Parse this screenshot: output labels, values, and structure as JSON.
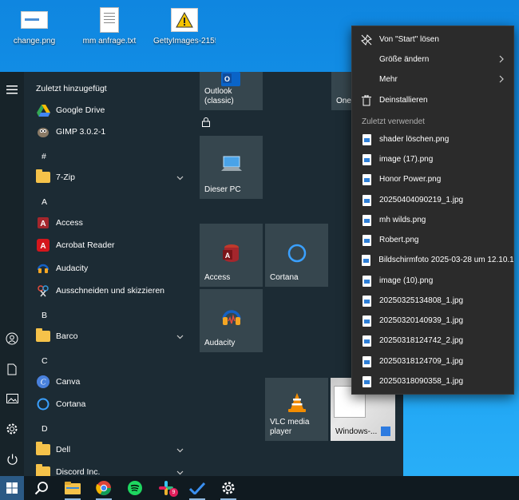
{
  "desktop": {
    "icons": [
      {
        "label": "change.png",
        "icon": "png-file-icon"
      },
      {
        "label": "mm anfrage.txt",
        "icon": "text-file-icon"
      },
      {
        "label": "GettyImages-21555...",
        "icon": "warning-icon"
      }
    ]
  },
  "start_menu": {
    "recently_added_label": "Zuletzt hinzugefügt",
    "apps": {
      "google_drive": "Google Drive",
      "gimp": "GIMP 3.0.2-1",
      "letter_hash": "#",
      "seven_zip": "7-Zip",
      "letter_a": "A",
      "access": "Access",
      "acrobat": "Acrobat Reader",
      "audacity": "Audacity",
      "snipping": "Ausschneiden und skizzieren",
      "letter_b": "B",
      "barco": "Barco",
      "letter_c": "C",
      "canva": "Canva",
      "cortana": "Cortana",
      "letter_d": "D",
      "dell": "Dell",
      "discord": "Discord Inc."
    },
    "tiles": {
      "outlook": "Outlook (classic)",
      "onenote_partial": "Onel",
      "this_pc": "Dieser PC",
      "access": "Access",
      "cortana": "Cortana",
      "audacity": "Audacity",
      "vlc": "VLC media player",
      "windows": "Windows-..."
    }
  },
  "context_menu": {
    "unpin": "Von \"Start\" lösen",
    "resize": "Größe ändern",
    "more": "Mehr",
    "uninstall": "Deinstallieren",
    "recent_header": "Zuletzt verwendet",
    "recent_files": [
      "shader löschen.png",
      "image (17).png",
      "Honor Power.png",
      "20250404090219_1.jpg",
      "mh wilds.png",
      "Robert.png",
      "Bildschirmfoto 2025-03-28 um 12.10.1...",
      "image (10).png",
      "20250325134808_1.jpg",
      "20250320140939_1.jpg",
      "20250318124742_2.jpg",
      "20250318124709_1.jpg",
      "20250318090358_1.jpg"
    ]
  },
  "taskbar": {
    "slack_badge": "9"
  },
  "colors": {
    "start_bg": "#1c2b34",
    "tile_bg": "#36464e",
    "menu_bg": "#2b2b2b",
    "taskbar_bg": "#101a20",
    "desktop_blue": "#0f86e0"
  }
}
